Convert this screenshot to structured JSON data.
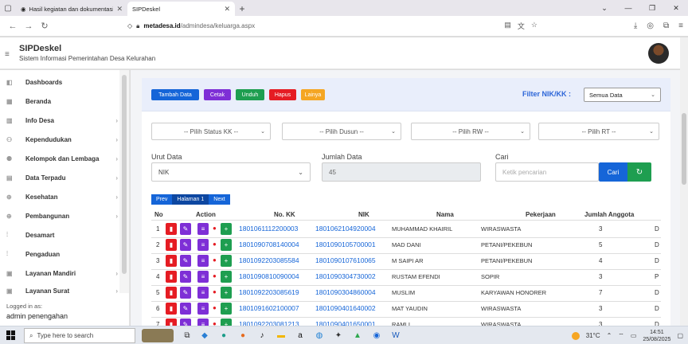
{
  "browser": {
    "tabs": [
      {
        "title": "Hasil kegiatan dan dokumentasi",
        "active": false
      },
      {
        "title": "SIPDeskel",
        "active": true
      }
    ],
    "new_tab": "+",
    "url_host": "metadesa.id",
    "url_path": "/admindesa/keluarga.aspx",
    "icons": {
      "back": "arrow-left",
      "forward": "arrow-right",
      "reload": "reload",
      "shield": "shield",
      "lock": "lock"
    }
  },
  "app": {
    "title": "SIPDeskel",
    "subtitle": "Sistem Informasi Pemerintahan Desa Kelurahan"
  },
  "sidebar": {
    "items": [
      {
        "label": "Dashboards",
        "has_chevron": false
      },
      {
        "label": "Beranda",
        "has_chevron": false
      },
      {
        "label": "Info Desa",
        "has_chevron": true
      },
      {
        "label": "Kependudukan",
        "has_chevron": true
      },
      {
        "label": "Kelompok dan Lembaga",
        "has_chevron": true
      },
      {
        "label": "Data Terpadu",
        "has_chevron": true
      },
      {
        "label": "Kesehatan",
        "has_chevron": true
      },
      {
        "label": "Pembangunan",
        "has_chevron": true
      },
      {
        "label": "Desamart",
        "has_chevron": false
      },
      {
        "label": "Pengaduan",
        "has_chevron": false
      },
      {
        "label": "Layanan Mandiri",
        "has_chevron": true
      },
      {
        "label": "Layanan Surat",
        "has_chevron": true
      }
    ],
    "logged_label": "Logged in as:",
    "logged_user": "admin penengahan"
  },
  "toolbar": {
    "buttons": [
      {
        "label": "Tambah Data",
        "color": "#1565d8"
      },
      {
        "label": "Cetak",
        "color": "#7e2fd6"
      },
      {
        "label": "Unduh",
        "color": "#1e9e50"
      },
      {
        "label": "Hapus",
        "color": "#e51c23"
      },
      {
        "label": "Lainya",
        "color": "#f5a623"
      }
    ],
    "filter_label": "Filter NIK/KK :",
    "filter_value": "Semua Data"
  },
  "filters": {
    "status_kk": "-- Pilih Status KK --",
    "dusun": "-- Pilih Dusun --",
    "rw": "-- Pilih RW --",
    "rt": "-- Pilih RT --"
  },
  "form": {
    "urut_label": "Urut Data",
    "urut_value": "NIK",
    "jumlah_label": "Jumlah Data",
    "jumlah_value": "45",
    "cari_label": "Cari",
    "cari_placeholder": "Ketik pencarian",
    "cari_button": "Cari"
  },
  "pager": {
    "prev": "Prev",
    "current": "Halaman 1",
    "next": "Next"
  },
  "table": {
    "headers": {
      "no": "No",
      "action": "Action",
      "nokk": "No. KK",
      "nik": "NIK",
      "nama": "Nama",
      "pekerjaan": "Pekerjaan",
      "jumlah": "Jumlah Anggota"
    },
    "rows": [
      {
        "no": "1",
        "nokk": "1801061112200003",
        "nik": "1801062104920004",
        "nama": "MUHAMMAD KHAIRIL",
        "pekerjaan": "WIRASWASTA",
        "jumlah": "3",
        "extra": "D"
      },
      {
        "no": "2",
        "nokk": "1801090708140004",
        "nik": "1801090105700001",
        "nama": "MAD DANI",
        "pekerjaan": "PETANI/PEKEBUN",
        "jumlah": "5",
        "extra": "D"
      },
      {
        "no": "3",
        "nokk": "1801092203085584",
        "nik": "1801090107610065",
        "nama": "M SAIPI AR",
        "pekerjaan": "PETANI/PEKEBUN",
        "jumlah": "4",
        "extra": "D"
      },
      {
        "no": "4",
        "nokk": "1801090810090004",
        "nik": "1801090304730002",
        "nama": "RUSTAM EFENDI",
        "pekerjaan": "SOPIR",
        "jumlah": "3",
        "extra": "P"
      },
      {
        "no": "5",
        "nokk": "1801092203085619",
        "nik": "1801090304860004",
        "nama": "MUSLIM",
        "pekerjaan": "KARYAWAN HONORER",
        "jumlah": "7",
        "extra": "D"
      },
      {
        "no": "6",
        "nokk": "1801091602100007",
        "nik": "1801090401640002",
        "nama": "MAT YAUDIN",
        "pekerjaan": "WIRASWASTA",
        "jumlah": "3",
        "extra": "D"
      },
      {
        "no": "7",
        "nokk": "1801092203081213",
        "nik": "1801090401650001",
        "nama": "RAMLI",
        "pekerjaan": "WIRASWASTA",
        "jumlah": "3",
        "extra": "D"
      }
    ]
  },
  "taskbar": {
    "search_placeholder": "Type here to search",
    "weather": "31°C",
    "time": "14:51",
    "date": "25/08/2025"
  }
}
